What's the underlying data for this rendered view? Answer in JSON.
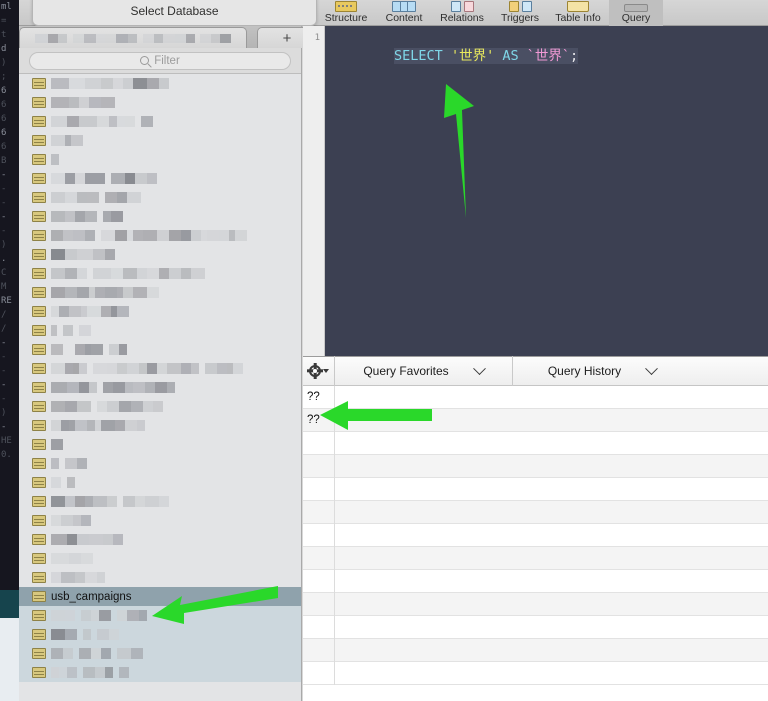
{
  "app": {
    "name": "Sequel Pro",
    "accent_green": "#2ad82a",
    "editor_bg": "#3c4052"
  },
  "toolbar": {
    "items": [
      {
        "label": "Structure",
        "icon": "structure-icon",
        "selected": false
      },
      {
        "label": "Content",
        "icon": "content-icon",
        "selected": false
      },
      {
        "label": "Relations",
        "icon": "relations-icon",
        "selected": false
      },
      {
        "label": "Triggers",
        "icon": "triggers-icon",
        "selected": false
      },
      {
        "label": "Table Info",
        "icon": "table-info-icon",
        "selected": false
      },
      {
        "label": "Query",
        "icon": "query-icon",
        "selected": true
      }
    ]
  },
  "sheet": {
    "title": "Select Database"
  },
  "tabs": {
    "database_tab_label": "",
    "new_tab_label": "+"
  },
  "filter": {
    "icon": "search-icon",
    "placeholder": "Filter",
    "value": ""
  },
  "sidebar": {
    "selected_table": "usb_campaigns",
    "table_icon": "table-icon",
    "rows": [
      {
        "blurred": true,
        "label": "",
        "widths": [
          18,
          16,
          16,
          12,
          10,
          10,
          14,
          12,
          10
        ]
      },
      {
        "blurred": true,
        "label": "",
        "widths": [
          18,
          10,
          10,
          12,
          14
        ]
      },
      {
        "blurred": true,
        "label": "",
        "widths": [
          16,
          12,
          18,
          12,
          8,
          8,
          10,
          0,
          12
        ]
      },
      {
        "blurred": true,
        "label": "",
        "widths": [
          14,
          6,
          12
        ]
      },
      {
        "blurred": true,
        "label": "",
        "widths": [
          8
        ]
      },
      {
        "blurred": true,
        "label": "",
        "widths": [
          14,
          10,
          10,
          20,
          0,
          14,
          10,
          12,
          10
        ]
      },
      {
        "blurred": true,
        "label": "",
        "widths": [
          14,
          12,
          10,
          12,
          0,
          12,
          10,
          14
        ]
      },
      {
        "blurred": true,
        "label": "",
        "widths": [
          14,
          10,
          10,
          12,
          0,
          8,
          12
        ]
      },
      {
        "blurred": true,
        "label": "",
        "widths": [
          12,
          10,
          12,
          10,
          0,
          14,
          12,
          6,
          10,
          14,
          12,
          12,
          10,
          10,
          6,
          12,
          10,
          6,
          12
        ]
      },
      {
        "blurred": true,
        "label": "",
        "widths": [
          14,
          12,
          16,
          12,
          10
        ]
      },
      {
        "blurred": true,
        "label": "",
        "widths": [
          14,
          12,
          10,
          0,
          18,
          12,
          14,
          10,
          12,
          10,
          12,
          10,
          14
        ]
      },
      {
        "blurred": true,
        "label": "",
        "widths": [
          14,
          12,
          12,
          6,
          10,
          12,
          6,
          10,
          14,
          12
        ]
      },
      {
        "blurred": true,
        "label": "",
        "widths": [
          8,
          10,
          12,
          6,
          14,
          10,
          6,
          12
        ]
      },
      {
        "blurred": true,
        "label": "",
        "widths": [
          6,
          0,
          10,
          0,
          12
        ]
      },
      {
        "blurred": true,
        "label": "",
        "widths": [
          12,
          0,
          0,
          10,
          6,
          12,
          0,
          10,
          8
        ]
      },
      {
        "blurred": true,
        "label": "",
        "widths": [
          14,
          8,
          6,
          8,
          0,
          14,
          10,
          10,
          12,
          8,
          10,
          10,
          14,
          10,
          8,
          0,
          12,
          10,
          6,
          10
        ]
      },
      {
        "blurred": true,
        "label": "",
        "widths": [
          16,
          12,
          10,
          8,
          0,
          10,
          12,
          8,
          12,
          10,
          12,
          8
        ]
      },
      {
        "blurred": true,
        "label": "",
        "widths": [
          14,
          12,
          14,
          0,
          10,
          12,
          12,
          12,
          10,
          10
        ]
      },
      {
        "blurred": true,
        "label": "",
        "widths": [
          10,
          8,
          6,
          12,
          8,
          6,
          14,
          10,
          12,
          8
        ]
      },
      {
        "blurred": true,
        "label": "",
        "widths": [
          12
        ]
      },
      {
        "blurred": true,
        "label": "",
        "widths": [
          8,
          0,
          12,
          10
        ]
      },
      {
        "blurred": true,
        "label": "",
        "widths": [
          10,
          0,
          8
        ]
      },
      {
        "blurred": true,
        "label": "",
        "widths": [
          14,
          10,
          10,
          8,
          14,
          10,
          0,
          12,
          10,
          14,
          10
        ]
      },
      {
        "blurred": true,
        "label": "",
        "widths": [
          10,
          12,
          8,
          10
        ]
      },
      {
        "blurred": true,
        "label": "",
        "widths": [
          16,
          10,
          12,
          14,
          10,
          10
        ]
      },
      {
        "blurred": true,
        "label": "",
        "widths": [
          18,
          12,
          12
        ]
      },
      {
        "blurred": true,
        "label": "",
        "widths": [
          10,
          14,
          10,
          12,
          8
        ]
      },
      {
        "selected": true,
        "label": "usb_campaigns"
      },
      {
        "blurred": true,
        "label": "",
        "widths": [
          14,
          10,
          0,
          10,
          8,
          12,
          0,
          10,
          12,
          8
        ]
      },
      {
        "blurred": true,
        "label": "",
        "widths": [
          14,
          12,
          0,
          8,
          0,
          12,
          10
        ]
      },
      {
        "blurred": true,
        "label": "",
        "widths": [
          12,
          10,
          0,
          12,
          10,
          10,
          0,
          14,
          12
        ]
      },
      {
        "blurred": true,
        "label": "",
        "widths": [
          8,
          8,
          10,
          0,
          12,
          10,
          8,
          0,
          10
        ]
      }
    ]
  },
  "editor": {
    "line_number": "1",
    "sql_tokens": [
      {
        "text": "SELECT",
        "type": "keyword"
      },
      {
        "text": " ",
        "type": "plain"
      },
      {
        "text": "'世界'",
        "type": "string"
      },
      {
        "text": " ",
        "type": "plain"
      },
      {
        "text": "AS",
        "type": "keyword"
      },
      {
        "text": " ",
        "type": "plain"
      },
      {
        "text": "`世界`",
        "type": "identifier"
      },
      {
        "text": ";",
        "type": "punctuation"
      }
    ],
    "sql_text": "SELECT '世界' AS `世界`;",
    "colors": {
      "keyword": "#7fd7e8",
      "string": "#e9e95d",
      "identifier": "#f39ad6",
      "punctuation": "#e8e8ec",
      "background": "#3c4052",
      "selection": "#4a4f63"
    }
  },
  "query_bar": {
    "gear_icon": "gear-icon",
    "gear_caret_icon": "caret-down-icon",
    "favorites_label": "Query Favorites",
    "favorites_caret_icon": "chevron-down-icon",
    "history_label": "Query History",
    "history_caret_icon": "chevron-down-icon"
  },
  "results": {
    "rows": [
      {
        "cells": [
          "??",
          ""
        ]
      },
      {
        "cells": [
          "??",
          ""
        ]
      },
      {
        "cells": [
          "",
          ""
        ]
      },
      {
        "cells": [
          "",
          ""
        ]
      },
      {
        "cells": [
          "",
          ""
        ]
      },
      {
        "cells": [
          "",
          ""
        ]
      },
      {
        "cells": [
          "",
          ""
        ]
      },
      {
        "cells": [
          "",
          ""
        ]
      },
      {
        "cells": [
          "",
          ""
        ]
      },
      {
        "cells": [
          "",
          ""
        ]
      },
      {
        "cells": [
          "",
          ""
        ]
      },
      {
        "cells": [
          "",
          ""
        ]
      },
      {
        "cells": [
          "",
          ""
        ]
      }
    ]
  },
  "annotations": [
    {
      "name": "arrow-to-sql-editor",
      "direction": "up-left",
      "color": "#2ad82a"
    },
    {
      "name": "arrow-to-result-row",
      "direction": "left",
      "color": "#2ad82a"
    },
    {
      "name": "arrow-to-selected-table",
      "direction": "left",
      "color": "#2ad82a"
    }
  ],
  "background_terminal": {
    "lines": [
      "ml",
      "=",
      "t",
      "d",
      ")",
      ";",
      "6",
      "6",
      "6",
      "6",
      "6",
      "B",
      "-",
      "-",
      "-",
      "-",
      "-",
      ")",
      ".",
      "C",
      "M",
      "RE",
      "/",
      "/",
      "-",
      "-",
      "-",
      "-",
      "-",
      ")",
      "-",
      "HE",
      "0."
    ]
  }
}
